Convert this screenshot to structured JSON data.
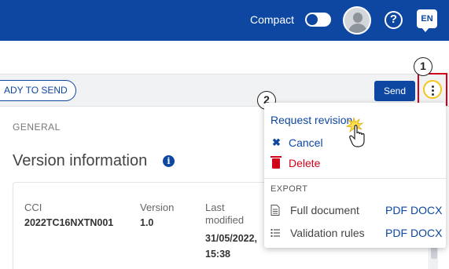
{
  "header": {
    "compact_label": "Compact",
    "compact_on": false,
    "lang_code": "EN"
  },
  "toolbar": {
    "status_label": "ADY TO SEND",
    "send_label": "Send"
  },
  "callouts": [
    "1",
    "2"
  ],
  "content": {
    "section_label": "GENERAL",
    "title": "Version information",
    "fields": [
      {
        "label": "CCI",
        "value": "2022TC16NXTN001"
      },
      {
        "label": "Version",
        "value": "1.0"
      },
      {
        "label": "Last modified",
        "value": "31/05/2022, 15:38"
      }
    ]
  },
  "menu": {
    "request_revision": "Request revision",
    "cancel": "Cancel",
    "delete": "Delete",
    "export_title": "EXPORT",
    "export_rows": [
      {
        "label": "Full document",
        "pdf": "PDF",
        "docx": "DOCX",
        "icon": "document-icon"
      },
      {
        "label": "Validation rules",
        "pdf": "PDF",
        "docx": "DOCX",
        "icon": "list-icon"
      }
    ]
  },
  "colors": {
    "primary": "#0e47a1",
    "danger": "#d0021b",
    "highlight": "#d0021b",
    "kebab_ring": "#f5c518"
  }
}
